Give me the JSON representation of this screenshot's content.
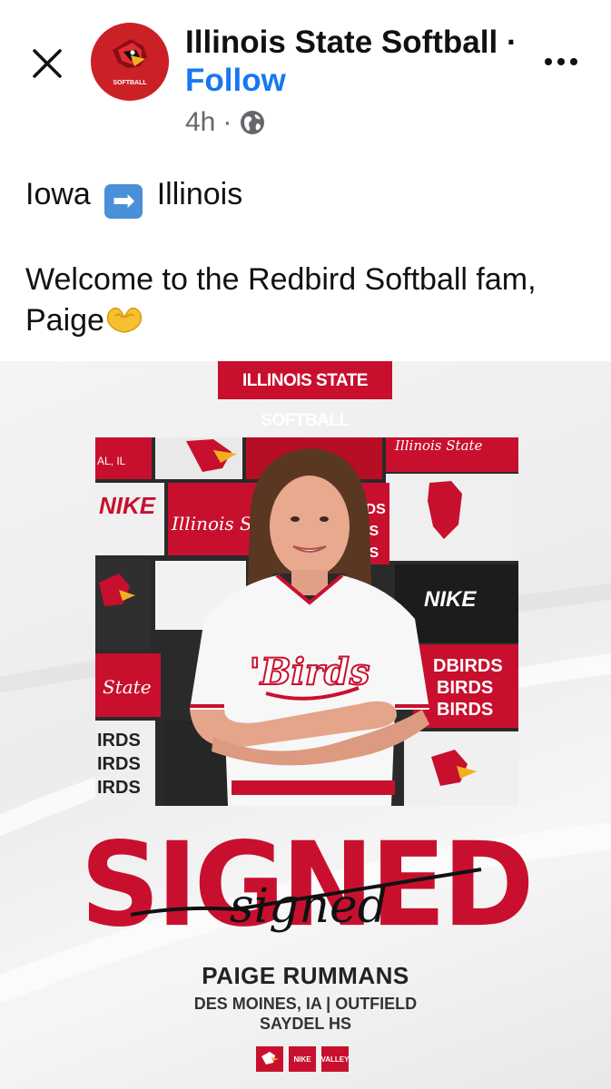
{
  "header": {
    "page_name": "Illinois State Softball",
    "separator": "·",
    "follow_label": "Follow",
    "time_ago": "4h",
    "meta_separator": "·",
    "avatar_text": "SOFTBALL"
  },
  "post": {
    "line1_from": "Iowa",
    "line1_arrow": "➡",
    "line1_to": "Illinois",
    "line2": "Welcome to the Redbird Softball fam, Paige"
  },
  "graphic": {
    "banner": "ILLINOIS STATE SOFTBALL",
    "headline": "SIGNED",
    "script_word": "signed",
    "player_name": "PAIGE RUMMANS",
    "hometown_position": "DES MOINES, IA | OUTFIELD",
    "high_school": "SAYDEL HS",
    "jersey_text": "'Birds",
    "backdrop_texts": [
      "Illinois St",
      "NIKE",
      "NIKE",
      "State",
      "DBIRDS",
      "BIRDS",
      "BIRDS",
      "IRDS",
      "IRDS",
      "IRDS",
      "RDS",
      "DS",
      "DS",
      "AL, IL",
      "Illinois State"
    ],
    "footer_logos": [
      "redbird-logo",
      "nike-logo",
      "valley-logo"
    ],
    "footer_logo_text": [
      "NIKE",
      "VALLEY"
    ]
  },
  "colors": {
    "accent_red": "#c8102e",
    "link_blue": "#1877f2",
    "meta_gray": "#65676b"
  }
}
